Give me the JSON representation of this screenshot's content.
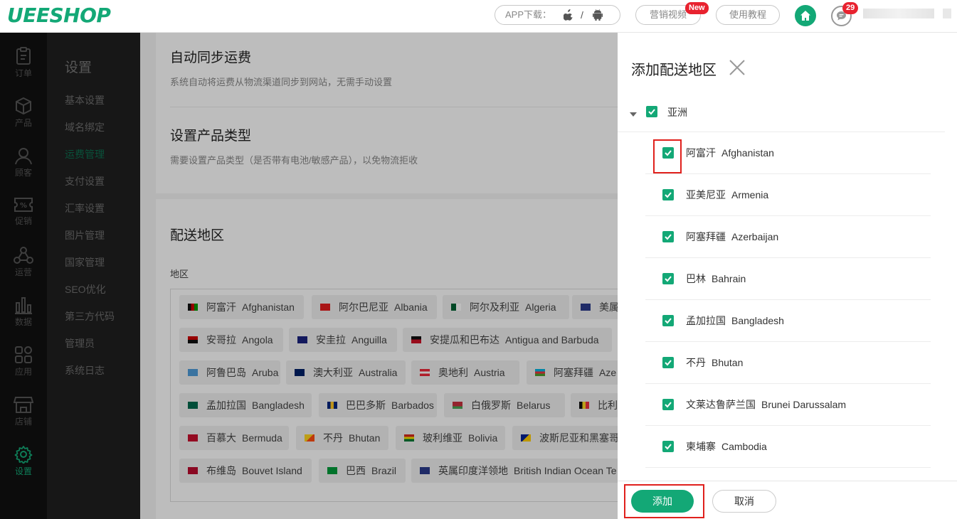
{
  "brand": {
    "logo_text": "UEESHOP",
    "accent": "#13a876"
  },
  "header": {
    "app_download_label": "APP下载：",
    "app_os_separator": "/",
    "marketing_video_label": "营销视频",
    "new_badge": "New",
    "tutorial_label": "使用教程",
    "message_count": "29"
  },
  "rail": [
    {
      "label": "订单",
      "icon": "clipboard-icon"
    },
    {
      "label": "产品",
      "icon": "box-icon"
    },
    {
      "label": "顾客",
      "icon": "user-icon"
    },
    {
      "label": "促销",
      "icon": "percent-ticket-icon"
    },
    {
      "label": "运营",
      "icon": "network-icon"
    },
    {
      "label": "数据",
      "icon": "bar-chart-icon"
    },
    {
      "label": "应用",
      "icon": "apps-grid-icon"
    },
    {
      "label": "店铺",
      "icon": "store-icon"
    },
    {
      "label": "设置",
      "icon": "gear-icon",
      "active": true
    }
  ],
  "settings_nav": {
    "title": "设置",
    "items": [
      "基本设置",
      "域名绑定",
      "运费管理",
      "支付设置",
      "汇率设置",
      "图片管理",
      "国家管理",
      "SEO优化",
      "第三方代码",
      "管理员",
      "系统日志"
    ],
    "active": "运费管理"
  },
  "main": {
    "auto_sync_title": "自动同步运费",
    "auto_sync_desc": "系统自动将运费从物流渠道同步到网站，无需手动设置",
    "product_type_title": "设置产品类型",
    "product_type_desc": "需要设置产品类型（是否带有电池/敏感产品），以免物流拒收",
    "region_title": "配送地区",
    "region_label": "地区",
    "tags": [
      {
        "cn": "阿富汗",
        "en": "Afghanistan"
      },
      {
        "cn": "阿尔巴尼亚",
        "en": "Albania"
      },
      {
        "cn": "阿尔及利亚",
        "en": "Algeria"
      },
      {
        "cn": "美属",
        "en": ""
      },
      {
        "cn": "安哥拉",
        "en": "Angola"
      },
      {
        "cn": "安圭拉",
        "en": "Anguilla"
      },
      {
        "cn": "安提瓜和巴布达",
        "en": "Antigua and Barbuda"
      },
      {
        "cn": "阿鲁巴岛",
        "en": "Aruba"
      },
      {
        "cn": "澳大利亚",
        "en": "Australia"
      },
      {
        "cn": "奥地利",
        "en": "Austria"
      },
      {
        "cn": "阿塞拜疆",
        "en": "Aze"
      },
      {
        "cn": "孟加拉国",
        "en": "Bangladesh"
      },
      {
        "cn": "巴巴多斯",
        "en": "Barbados"
      },
      {
        "cn": "白俄罗斯",
        "en": "Belarus"
      },
      {
        "cn": "比利时",
        "en": ""
      },
      {
        "cn": "百慕大",
        "en": "Bermuda"
      },
      {
        "cn": "不丹",
        "en": "Bhutan"
      },
      {
        "cn": "玻利维亚",
        "en": "Bolivia"
      },
      {
        "cn": "波斯尼亚和黑塞哥",
        "en": ""
      },
      {
        "cn": "布维岛",
        "en": "Bouvet Island"
      },
      {
        "cn": "巴西",
        "en": "Brazil"
      },
      {
        "cn": "英属印度洋领地",
        "en": "British Indian Ocean Te"
      }
    ]
  },
  "drawer": {
    "title": "添加配送地区",
    "group_label": "亚洲",
    "countries": [
      {
        "cn": "阿富汗",
        "en": "Afghanistan",
        "checked": true
      },
      {
        "cn": "亚美尼亚",
        "en": "Armenia",
        "checked": true
      },
      {
        "cn": "阿塞拜疆",
        "en": "Azerbaijan",
        "checked": true
      },
      {
        "cn": "巴林",
        "en": "Bahrain",
        "checked": true
      },
      {
        "cn": "孟加拉国",
        "en": "Bangladesh",
        "checked": true
      },
      {
        "cn": "不丹",
        "en": "Bhutan",
        "checked": true
      },
      {
        "cn": "文莱达鲁萨兰国",
        "en": "Brunei Darussalam",
        "checked": true
      },
      {
        "cn": "柬埔寨",
        "en": "Cambodia",
        "checked": true
      }
    ],
    "add_button": "添加",
    "cancel_button": "取消"
  }
}
